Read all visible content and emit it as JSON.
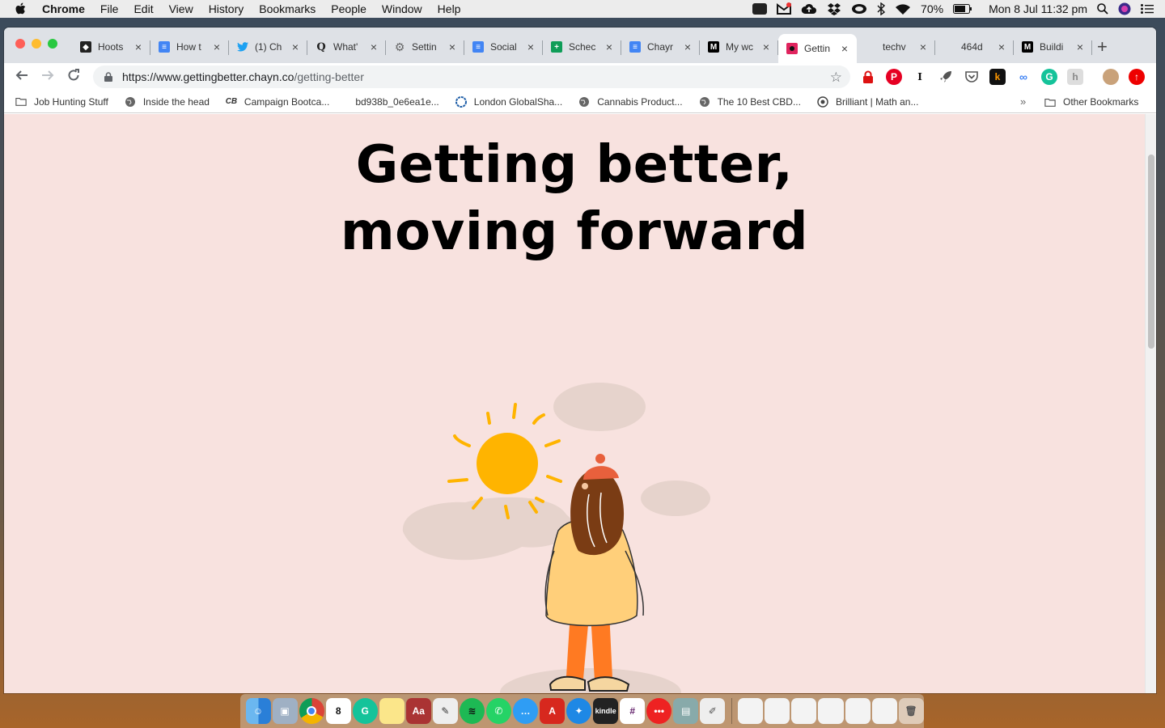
{
  "menubar": {
    "app": "Chrome",
    "items": [
      "File",
      "Edit",
      "View",
      "History",
      "Bookmarks",
      "People",
      "Window",
      "Help"
    ],
    "battery": "70%",
    "clock": "Mon 8 Jul  11:32 pm"
  },
  "tabs": [
    {
      "label": "Hoots",
      "color": "#222222",
      "glyph": "◆"
    },
    {
      "label": "How t",
      "color": "#4285f4",
      "glyph": "≡"
    },
    {
      "label": "(1) Ch",
      "color": "#1da1f2",
      "glyph": "t"
    },
    {
      "label": "What'",
      "color": "#ffffff",
      "glyph": "Q"
    },
    {
      "label": "Settin",
      "color": "#ffffff",
      "glyph": "⚙"
    },
    {
      "label": "Social",
      "color": "#4285f4",
      "glyph": "≡"
    },
    {
      "label": "Schec",
      "color": "#0f9d58",
      "glyph": "+"
    },
    {
      "label": "Chayr",
      "color": "#4285f4",
      "glyph": "≡"
    },
    {
      "label": "My wc",
      "color": "#000000",
      "glyph": "M"
    },
    {
      "label": "Gettin",
      "color": "#e0245e",
      "glyph": "●"
    },
    {
      "label": "techv",
      "color": "#ffffff",
      "glyph": ""
    },
    {
      "label": "464d",
      "color": "#ffffff",
      "glyph": ""
    },
    {
      "label": "Buildi",
      "color": "#000000",
      "glyph": "M"
    }
  ],
  "address": {
    "host": "https://www.gettingbetter.chayn.co",
    "path": "/getting-better"
  },
  "bookmarks": [
    "Job Hunting Stuff",
    "Inside the head",
    "Campaign Bootca...",
    "bd938b_0e6ea1e...",
    "London GlobalSha...",
    "Cannabis Product...",
    "The 10 Best CBD...",
    "Brilliant | Math an..."
  ],
  "bookmarks_overflow": "»",
  "other_bookmarks": "Other Bookmarks",
  "page": {
    "title_line1": "Getting better,",
    "title_line2": "moving forward"
  },
  "colors": {
    "page_bg": "#f8e2df",
    "sun": "#ffb400",
    "cloud": "#e6d3cc"
  }
}
